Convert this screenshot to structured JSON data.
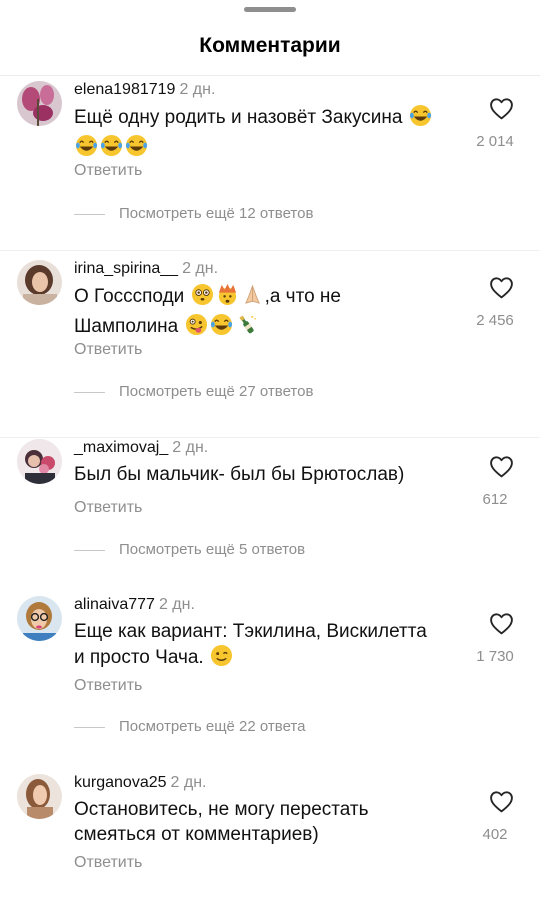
{
  "header": {
    "title": "Комментарии"
  },
  "comments": [
    {
      "username": "elena1981719",
      "time": "2 дн.",
      "text_line1": "Ещё одну родить и назовёт Закусина",
      "text_line2": "",
      "likes": "2 014",
      "reply": "Ответить",
      "more_replies": "Посмотреть ещё 12 ответов"
    },
    {
      "username": "irina_spirina__",
      "time": "2 дн.",
      "text_line1": "О Госссподи",
      "text_line1b": ",а что не",
      "text_line2": "Шамполина",
      "likes": "2 456",
      "reply": "Ответить",
      "more_replies": "Посмотреть ещё 27 ответов"
    },
    {
      "username": "_maximovaj_",
      "time": "2 дн.",
      "text_line1": "Был бы мальчик- был бы Брютослав)",
      "likes": "612",
      "reply": "Ответить",
      "more_replies": "Посмотреть ещё 5 ответов"
    },
    {
      "username": "alinaiva777",
      "time": "2 дн.",
      "text_line1": "Еще как вариант: Тэкилина, Вискилетта",
      "text_line2": "и просто Чача.",
      "likes": "1 730",
      "reply": "Ответить",
      "more_replies": "Посмотреть ещё 22 ответа"
    },
    {
      "username": "kurganova25",
      "time": "2 дн.",
      "text_line1": "Остановитесь, не могу перестать",
      "text_line2": "смеяться от комментариев)",
      "likes": "402",
      "reply": "Ответить"
    }
  ]
}
